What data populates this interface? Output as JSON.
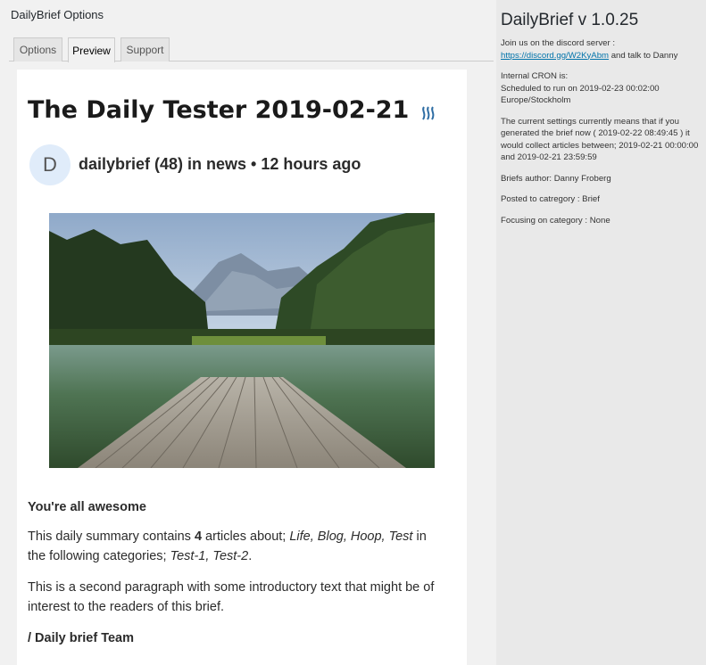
{
  "header": {
    "title": "DailyBrief Options"
  },
  "tabs": [
    {
      "label": "Options"
    },
    {
      "label": "Preview"
    },
    {
      "label": "Support"
    }
  ],
  "post": {
    "title": "The Daily Tester 2019-02-21",
    "avatar_letter": "D",
    "author_line": "dailybrief (48) in news • 12 hours ago",
    "section_heading": "You're all awesome",
    "summary_prefix": "This daily summary contains ",
    "article_count": "4",
    "summary_mid": " articles about; ",
    "topics": "Life, Blog, Hoop, Test",
    "summary_in": " in",
    "summary_cat_prefix": "the following categories; ",
    "categories": "Test-1, Test-2",
    "summary_end": ".",
    "paragraph2": "This is a second paragraph with some introductory text that might be of interest to the readers of this brief.",
    "signoff": "/ Daily brief Team"
  },
  "sidebar": {
    "title": "DailyBrief v 1.0.25",
    "discord_text": "Join us on the discord server :",
    "discord_link": "https://discord.gg/W2KyAbm",
    "discord_suffix": " and talk to Danny",
    "cron_label": "Internal CRON is:",
    "cron_schedule": "Scheduled to run on 2019-02-23 00:02:00",
    "cron_timezone": "Europe/Stockholm",
    "settings_note": "The current settings currently means that if you generated the brief now ( 2019-02-22 08:49:45 ) it would collect articles between; 2019-02-21 00:00:00 and 2019-02-21 23:59:59",
    "author": "Briefs author: Danny Froberg",
    "posted_category": "Posted to catregory : Brief",
    "focus_category": "Focusing on category : None"
  }
}
